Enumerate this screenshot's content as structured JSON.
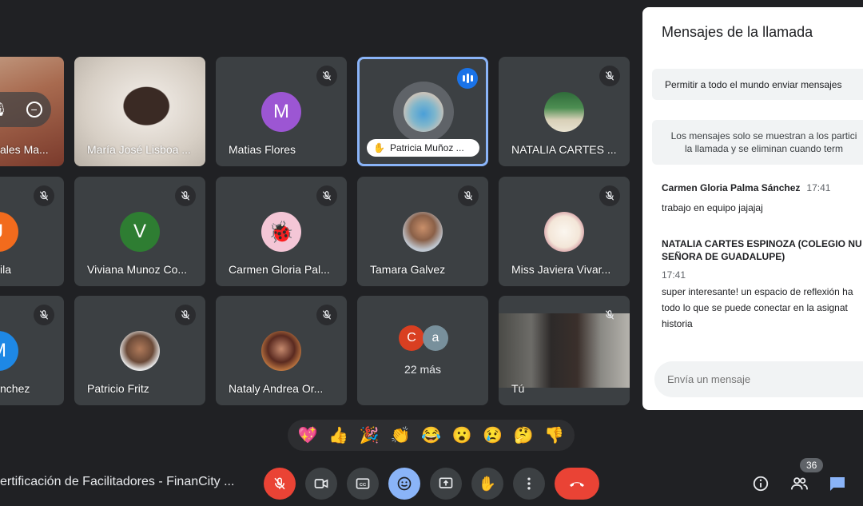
{
  "meeting_title": "ertificación de Facilitadores - FinanCity ...",
  "participants": [
    {
      "name": "ales Ma...",
      "initial": ""
    },
    {
      "name": "María José Lisboa ...",
      "initial": ""
    },
    {
      "name": "Matias Flores",
      "initial": "M"
    },
    {
      "name": "Patricia Muñoz ...",
      "initial": ""
    },
    {
      "name": "NATALIA CARTES ...",
      "initial": ""
    },
    {
      "name": "ila",
      "initial": "J"
    },
    {
      "name": "Viviana Munoz Co...",
      "initial": "V"
    },
    {
      "name": "Carmen Gloria Pal...",
      "initial": ""
    },
    {
      "name": "Tamara Galvez",
      "initial": ""
    },
    {
      "name": "Miss Javiera Vivar...",
      "initial": ""
    },
    {
      "name": "nchez",
      "initial": "M"
    },
    {
      "name": "Patricio Fritz",
      "initial": ""
    },
    {
      "name": "Nataly Andrea Or...",
      "initial": ""
    },
    {
      "name": "22 más",
      "initial": ""
    },
    {
      "name": "Tú",
      "initial": ""
    }
  ],
  "more_avatars": [
    "C",
    "a"
  ],
  "reactions": [
    "💖",
    "👍",
    "🎉",
    "👏",
    "😂",
    "😮",
    "😢",
    "🤔",
    "👎"
  ],
  "controls": {
    "mic": "mic-off-icon",
    "camera": "videocam-icon",
    "captions": "closed-captions-icon",
    "emoji": "emoji-icon",
    "present": "present-screen-icon",
    "raise_hand": "raise-hand-icon",
    "more": "more-vert-icon",
    "leave": "call-end-icon"
  },
  "side_controls": {
    "participant_count": "36"
  },
  "chat": {
    "title": "Mensajes de la llamada",
    "allow_all": "Permitir a todo el mundo enviar mensajes",
    "info_line1": "Los mensajes solo se muestran a los partici",
    "info_line2": "la llamada y se eliminan cuando term",
    "messages": [
      {
        "author": "Carmen Gloria Palma Sánchez",
        "time": "17:41",
        "lines": [
          "trabajo en equipo jajajaj"
        ]
      },
      {
        "author_line1": "NATALIA CARTES ESPINOZA (COLEGIO NU",
        "author_line2": "SEÑORA DE GUADALUPE)",
        "time": "17:41",
        "lines": [
          "super interesante! un espacio de reflexión ha",
          "todo lo que se puede conectar en la asignat",
          "historia"
        ]
      }
    ],
    "input_placeholder": "Envía un mensaje"
  },
  "colors": {
    "background": "#202124",
    "tile": "#3c4043",
    "accent": "#8ab4f8",
    "danger": "#ea4335"
  }
}
